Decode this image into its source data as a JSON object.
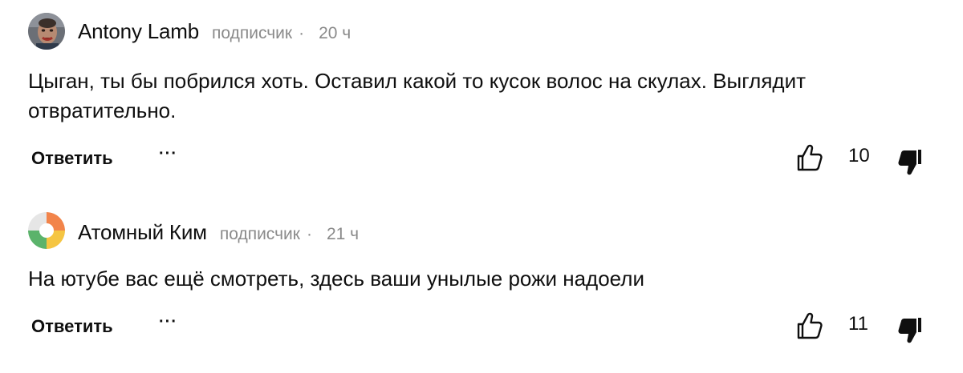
{
  "comments": [
    {
      "author": "Antony Lamb",
      "badge": "подписчик",
      "separator": "·",
      "time": "20 ч",
      "text": "Цыган, ты бы побрился хоть. Оставил какой то кусок волос на скулах. Выглядит отвратительно.",
      "reply_label": "Ответить",
      "more_label": "···",
      "likes": "10",
      "avatar_icon": "photo-avatar"
    },
    {
      "author": "Атомный Ким",
      "badge": "подписчик",
      "separator": "·",
      "time": "21 ч",
      "text": "На ютубе вас ещё смотреть, здесь ваши унылые рожи надоели",
      "reply_label": "Ответить",
      "more_label": "···",
      "likes": "11",
      "avatar_icon": "four-color-pinwheel-avatar",
      "avatar_colors": [
        "#f2844a",
        "#f5c542",
        "#5bb36b",
        "#e0e0e0"
      ]
    }
  ]
}
